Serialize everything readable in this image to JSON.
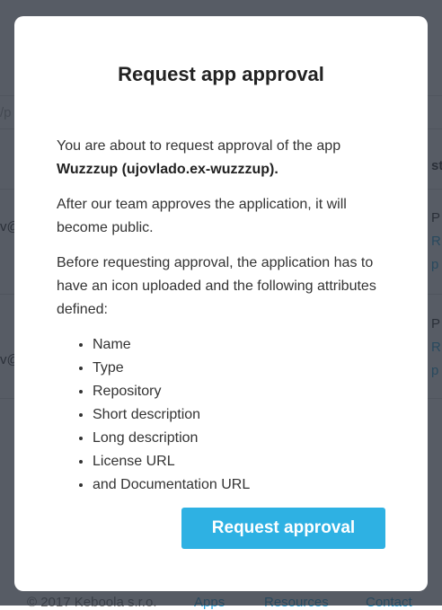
{
  "background": {
    "fragments": {
      "left_top": "/p",
      "left_row1": "v@",
      "left_row2": "v@",
      "right_header": "st",
      "right_r1a": "P",
      "right_r1b": "R",
      "right_r1c": "p",
      "right_r2a": "P",
      "right_r2b": "R",
      "right_r2c": "p"
    },
    "footer": {
      "copyright": "© 2017 Keboola s.r.o.",
      "apps": "Apps",
      "resources": "Resources",
      "contact": "Contact"
    }
  },
  "modal": {
    "title": "Request app approval",
    "intro": "You are about to request approval of the app",
    "app_name": "Wuzzzup (ujovlado.ex-wuzzzup).",
    "after": "After our team approves the application, it will become public.",
    "before": "Before requesting approval, the application has to have an icon uploaded and the following attributes defined:",
    "attributes": [
      "Name",
      "Type",
      "Repository",
      "Short description",
      "Long description",
      "License URL",
      "and Documentation URL"
    ],
    "button_label": "Request approval"
  },
  "colors": {
    "accent": "#2eb1e3"
  }
}
